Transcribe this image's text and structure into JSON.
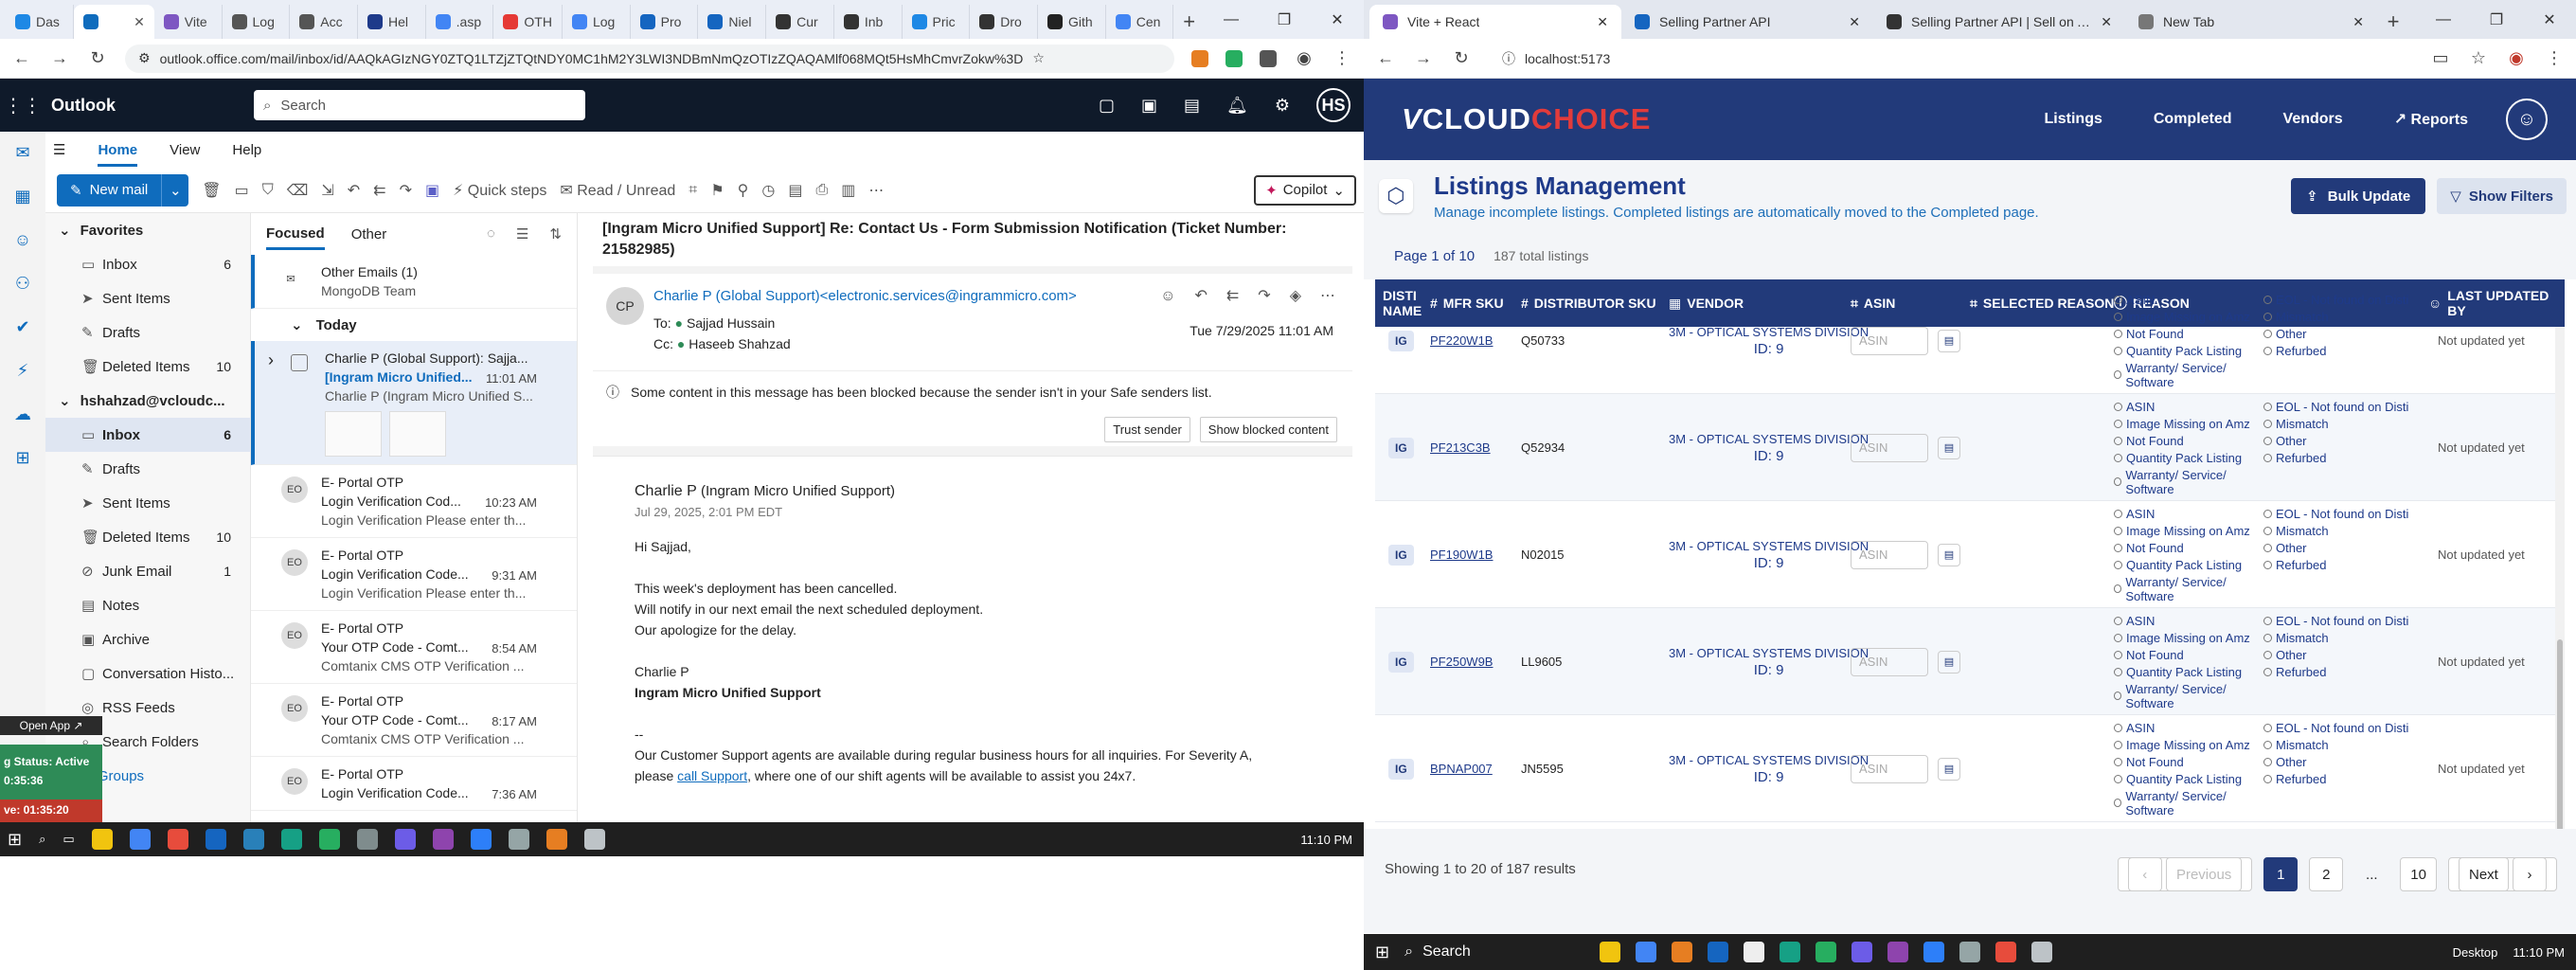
{
  "left": {
    "tabs": [
      {
        "label": "Das",
        "color": "#1e88e5"
      },
      {
        "label": "",
        "color": "#0f6cbd",
        "active": true
      },
      {
        "label": "Vite",
        "color": "#7e57c2"
      },
      {
        "label": "Log",
        "color": "#555555"
      },
      {
        "label": "Acc",
        "color": "#555555"
      },
      {
        "label": "Hel",
        "color": "#1e3a8a"
      },
      {
        "label": ".asp",
        "color": "#4285f4"
      },
      {
        "label": "OTH",
        "color": "#e53935"
      },
      {
        "label": "Log",
        "color": "#4285f4"
      },
      {
        "label": "Pro",
        "color": "#1565c0"
      },
      {
        "label": "Niel",
        "color": "#1565c0"
      },
      {
        "label": "Cur",
        "color": "#333333"
      },
      {
        "label": "Inb",
        "color": "#333333"
      },
      {
        "label": "Pric",
        "color": "#1e88e5"
      },
      {
        "label": "Dro",
        "color": "#333333"
      },
      {
        "label": "Gith",
        "color": "#222222"
      },
      {
        "label": "Cen",
        "color": "#4285f4"
      }
    ],
    "url": "outlook.office.com/mail/inbox/id/AAQkAGIzNGY0ZTQ1LTZjZTQtNDY0MC1hM2Y3LWI3NDBmNmQzOTIzZQAQAMlf068MQt5HsMhCmvrZokw%3D",
    "outlook": {
      "brand": "Outlook",
      "search_placeholder": "Search",
      "user_initials": "HS",
      "ribbon_tabs": [
        "Home",
        "View",
        "Help"
      ],
      "new_mail": "New mail",
      "quick_steps": "Quick steps",
      "read_unread": "Read / Unread",
      "copilot": "Copilot",
      "favorites_header": "Favorites",
      "favorites": [
        {
          "label": "Inbox",
          "count": "6"
        },
        {
          "label": "Sent Items",
          "count": ""
        },
        {
          "label": "Drafts",
          "count": ""
        },
        {
          "label": "Deleted Items",
          "count": "10"
        }
      ],
      "account_header": "hshahzad@vcloudc...",
      "folders": [
        {
          "label": "Inbox",
          "count": "6",
          "selected": true
        },
        {
          "label": "Drafts",
          "count": ""
        },
        {
          "label": "Sent Items",
          "count": ""
        },
        {
          "label": "Deleted Items",
          "count": "10"
        },
        {
          "label": "Junk Email",
          "count": "1"
        },
        {
          "label": "Notes",
          "count": ""
        },
        {
          "label": "Archive",
          "count": ""
        },
        {
          "label": "Conversation Histo...",
          "count": ""
        },
        {
          "label": "RSS Feeds",
          "count": ""
        },
        {
          "label": "Search Folders",
          "count": ""
        }
      ],
      "go_to_groups": "Go to Groups",
      "list_tabs": {
        "focused": "Focused",
        "other": "Other"
      },
      "other_emails": {
        "title": "Other Emails (1)",
        "sub": "MongoDB Team"
      },
      "today": "Today",
      "messages": [
        {
          "initials": "",
          "sender": "Charlie P (Global Support): Sajja...",
          "subject": "[Ingram Micro Unified...",
          "time": "11:01 AM",
          "preview": "Charlie P (Ingram Micro Unified S...",
          "selected": true
        },
        {
          "initials": "EO",
          "sender": "E- Portal OTP",
          "subject": "Login Verification Cod...",
          "time": "10:23 AM",
          "preview": "Login Verification Please enter th..."
        },
        {
          "initials": "EO",
          "sender": "E- Portal OTP",
          "subject": "Login Verification Code...",
          "time": "9:31 AM",
          "preview": "Login Verification Please enter th..."
        },
        {
          "initials": "EO",
          "sender": "E- Portal OTP",
          "subject": "Your OTP Code - Comt...",
          "time": "8:54 AM",
          "preview": "Comtanix CMS OTP Verification ..."
        },
        {
          "initials": "EO",
          "sender": "E- Portal OTP",
          "subject": "Your OTP Code - Comt...",
          "time": "8:17 AM",
          "preview": "Comtanix CMS OTP Verification ..."
        },
        {
          "initials": "EO",
          "sender": "E- Portal OTP",
          "subject": "Login Verification Code...",
          "time": "7:36 AM",
          "preview": ""
        }
      ],
      "read": {
        "subject": "[Ingram Micro Unified Support] Re: Contact Us - Form Submission Notification (Ticket Number: 21582985)",
        "from": "Charlie P (Global Support)<electronic.services@ingrammicro.com>",
        "avatar": "CP",
        "to_label": "To:",
        "to": "Sajjad Hussain",
        "cc_label": "Cc:",
        "cc": "Haseeb Shahzad",
        "date": "Tue 7/29/2025 11:01 AM",
        "warning": "Some content in this message has been blocked because the sender isn't in your Safe senders list.",
        "trust": "Trust sender",
        "show_blocked": "Show blocked content",
        "sender_name": "Charlie P",
        "sender_org": "(Ingram Micro Unified Support)",
        "sent_date": "Jul 29, 2025, 2:01 PM EDT",
        "greeting": "Hi Sajjad,",
        "line1": "This week's deployment has been cancelled.",
        "line2": "Will notify in our next email the next scheduled deployment.",
        "line3": "Our apologize for the delay.",
        "sig1": "Charlie P",
        "sig2": "Ingram Micro Unified Support",
        "sep": "--",
        "support1": "Our Customer Support agents are available during regular business hours for all inquiries. For Severity A,",
        "support2a": "please ",
        "support_link": "call Support",
        "support2b": ", where one of our shift agents will be available to assist you 24x7."
      }
    },
    "overlay": {
      "open_app": "Open App",
      "status1": "g Status: Active",
      "time1": "0:35:36",
      "status2": "ve: 01:35:20"
    },
    "clock": "11:10 PM"
  },
  "right": {
    "tabs": [
      {
        "label": "Vite + React",
        "active": true,
        "color": "#7e57c2"
      },
      {
        "label": "Selling Partner API",
        "color": "#1565c0"
      },
      {
        "label": "Selling Partner API | Sell on Am",
        "color": "#333333"
      },
      {
        "label": "New Tab",
        "color": "#777777"
      }
    ],
    "url": "localhost:5173",
    "logo": {
      "v": "V",
      "c1": "CLOUD",
      "c2": "CHOICE"
    },
    "nav": [
      "Listings",
      "Completed",
      "Vendors",
      "↗ Reports"
    ],
    "title": "Listings Management",
    "subtitle": "Manage incomplete listings. Completed listings are automatically moved to the Completed page.",
    "bulk": "Bulk Update",
    "filters": "Show Filters",
    "page_info": "Page 1 of 10",
    "total": "187 total listings",
    "columns": [
      "DISTI NAME",
      "MFR SKU",
      "DISTRIBUTOR SKU",
      "VENDOR",
      "ASIN",
      "SELECTED REASON",
      "REASON",
      "LAST UPDATED BY"
    ],
    "reasons_left": [
      "ASIN",
      "Image Missing on Amz",
      "Not Found",
      "Quantity Pack Listing",
      "Warranty/ Service/ Software"
    ],
    "reasons_right": [
      "EOL - Not found on Disti",
      "Mismatch",
      "Other",
      "Refurbed"
    ],
    "rows": [
      {
        "disti": "IG",
        "mfr": "PF220W1B",
        "dsku": "Q50733",
        "vendor": "3M - OPTICAL SYSTEMS DIVISION",
        "vid": "ID: 9",
        "asin": "ASIN",
        "updated": "Not updated yet"
      },
      {
        "disti": "IG",
        "mfr": "PF213C3B",
        "dsku": "Q52934",
        "vendor": "3M - OPTICAL SYSTEMS DIVISION",
        "vid": "ID: 9",
        "asin": "ASIN",
        "updated": "Not updated yet"
      },
      {
        "disti": "IG",
        "mfr": "PF190W1B",
        "dsku": "N02015",
        "vendor": "3M - OPTICAL SYSTEMS DIVISION",
        "vid": "ID: 9",
        "asin": "ASIN",
        "updated": "Not updated yet"
      },
      {
        "disti": "IG",
        "mfr": "PF250W9B",
        "dsku": "LL9605",
        "vendor": "3M - OPTICAL SYSTEMS DIVISION",
        "vid": "ID: 9",
        "asin": "ASIN",
        "updated": "Not updated yet"
      },
      {
        "disti": "IG",
        "mfr": "BPNAP007",
        "dsku": "JN5595",
        "vendor": "3M - OPTICAL SYSTEMS DIVISION",
        "vid": "ID: 9",
        "asin": "ASIN",
        "updated": "Not updated yet"
      }
    ],
    "showing": "Showing 1 to 20 of 187 results",
    "pagination": {
      "prev": "Previous",
      "p1": "1",
      "p2": "2",
      "dots": "...",
      "p10": "10",
      "next": "Next"
    },
    "taskbar": {
      "search": "Search",
      "desktop": "Desktop",
      "clock": "11:10 PM"
    }
  }
}
